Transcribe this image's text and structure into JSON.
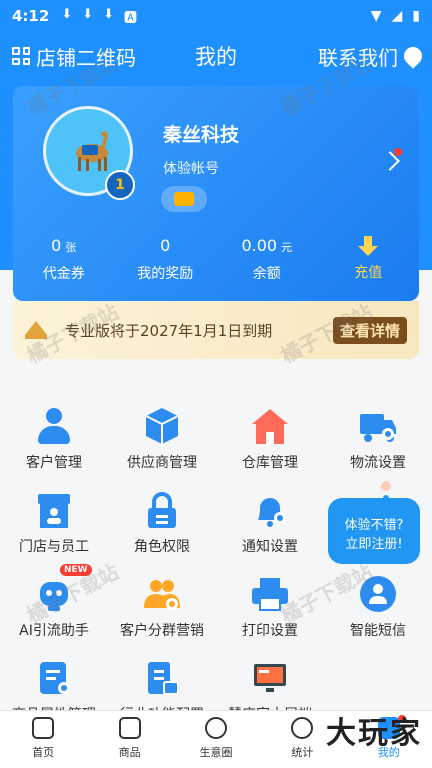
{
  "status_bar": {
    "time": "4:12",
    "left_icons": [
      "download-icon",
      "download-icon",
      "download-icon",
      "a-icon"
    ],
    "right_icons": [
      "wifi-icon",
      "signal-icon",
      "battery-icon"
    ]
  },
  "header": {
    "left_label": "店铺二维码",
    "title": "我的",
    "right_label": "联系我们"
  },
  "profile": {
    "company": "秦丝科技",
    "account_type": "体验帐号",
    "level": "1"
  },
  "stats": [
    {
      "value": "0",
      "unit": "张",
      "label": "代金券"
    },
    {
      "value": "0",
      "unit": "",
      "label": "我的奖励"
    },
    {
      "value": "0.00",
      "unit": "元",
      "label": "余额"
    },
    {
      "value": "",
      "unit": "",
      "label": "充值"
    }
  ],
  "pro_banner": {
    "text": "专业版将于2027年1月1日到期",
    "button": "查看详情"
  },
  "grid_items": [
    {
      "label": "客户管理",
      "icon": "customer-icon"
    },
    {
      "label": "供应商管理",
      "icon": "supplier-icon"
    },
    {
      "label": "仓库管理",
      "icon": "warehouse-icon"
    },
    {
      "label": "物流设置",
      "icon": "logistics-icon"
    },
    {
      "label": "门店与员工",
      "icon": "store-icon"
    },
    {
      "label": "角色权限",
      "icon": "lock-icon"
    },
    {
      "label": "通知设置",
      "icon": "bell-icon"
    },
    {
      "label": "",
      "icon": ""
    },
    {
      "label": "AI引流助手",
      "icon": "robot-icon",
      "badge": "NEW"
    },
    {
      "label": "客户分群营销",
      "icon": "group-icon"
    },
    {
      "label": "打印设置",
      "icon": "printer-icon"
    },
    {
      "label": "智能短信",
      "icon": "message-icon"
    },
    {
      "label": "商品属性管理",
      "icon": "tag-icon"
    },
    {
      "label": "行业功能配置",
      "icon": "config-icon"
    },
    {
      "label": "慧店家大屏端",
      "icon": "screen-icon"
    }
  ],
  "float_promo": {
    "line1": "体验不错?",
    "line2": "立即注册!"
  },
  "bottom_nav": [
    {
      "label": "首页",
      "icon": "home-icon"
    },
    {
      "label": "商品",
      "icon": "shop-icon"
    },
    {
      "label": "生意圈",
      "icon": "circle-icon"
    },
    {
      "label": "统计",
      "icon": "stats-icon"
    },
    {
      "label": "我的",
      "icon": "profile-icon"
    }
  ],
  "watermark": "橘子下载站",
  "corner_logo": "大玩家",
  "colors": {
    "primary": "#1e90ff",
    "accent_gold": "#ffd54f",
    "badge_red": "#ff3b30"
  }
}
